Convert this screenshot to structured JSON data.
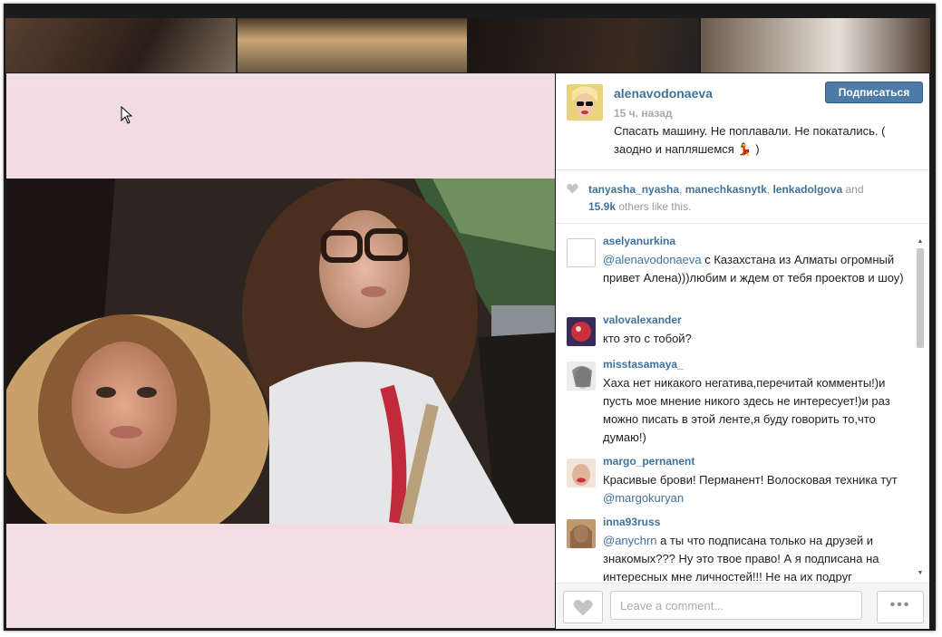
{
  "post": {
    "username": "alenavodonaeva",
    "follow_label": "Подписаться",
    "time": "15 ч. назад",
    "caption": "Спасать машину. Не поплавали. Не покатались. ( заодно и напляшемся 💃 )"
  },
  "likes": {
    "users": [
      "tanyasha_nyasha",
      "manechkasnytk",
      "lenkadolgova"
    ],
    "sep": ", ",
    "and": " and",
    "count": "15.9k",
    "others": " others like this."
  },
  "comments": [
    {
      "user": "aselyanurkina",
      "mention": "@alenavodonaeva",
      "text": " с Казахстана из Алматы огромный привет Алена)))любим и ждем от тебя проектов и шоу)",
      "avatar_color": "#f2f2f2"
    },
    {
      "user": "valovalexander",
      "mention": "",
      "text": "кто это с тобой?",
      "avatar_color": "#b0323c"
    },
    {
      "user": "misstasamaya_",
      "mention": "",
      "text": "Хаха нет никакого негатива,перечитай комменты!)и пусть мое мнение никого здесь не интересует!)и раз можно писать в этой ленте,я буду говорить то,что думаю!)",
      "avatar_color": "#d8d8d8"
    },
    {
      "user": "margo_pernanent",
      "mention": "",
      "text": "Красивые брови! Перманент! Волосковая техника тут ",
      "mention_end": "@margokuryan",
      "avatar_color": "#e6c9b6"
    },
    {
      "user": "inna93russ",
      "mention": "@anychrn",
      "text": " а ты что подписана только на друзей и знакомых??? Ну это твое право! А я подписана на интересных мне личностей!!! Не на их подруг",
      "avatar_color": "#c09a6c"
    }
  ],
  "comment_input": {
    "placeholder": "Leave a comment..."
  },
  "more_label": "•••",
  "icons": [
    "heart-icon",
    "cursor-icon",
    "scroll-up-icon",
    "scroll-down-icon",
    "more-icon"
  ],
  "colors": {
    "accent": "#3f729b",
    "follow_bg": "#4d7ba6"
  }
}
